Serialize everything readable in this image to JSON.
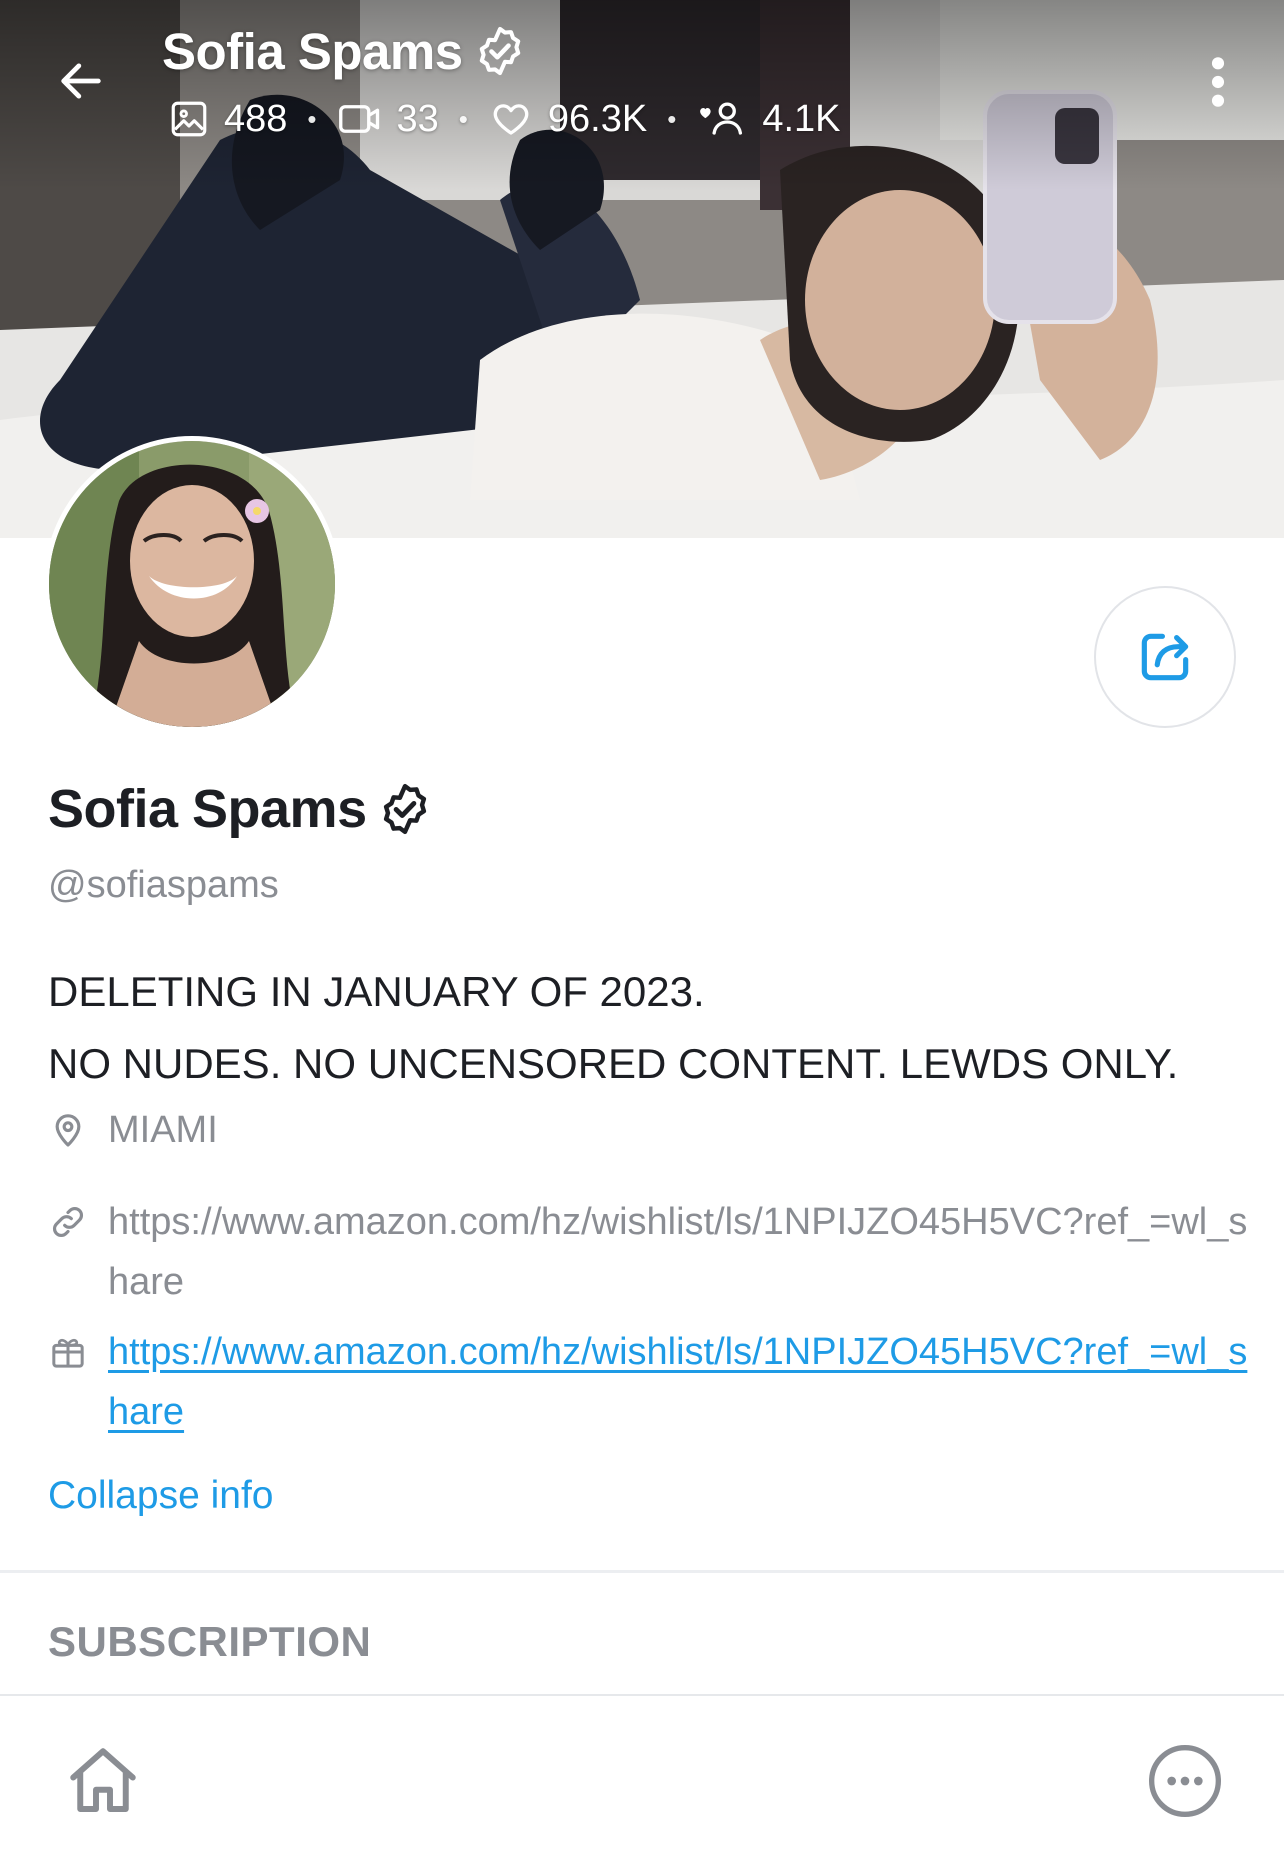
{
  "header": {
    "title": "Sofia Spams",
    "stats": {
      "photos": "488",
      "videos": "33",
      "likes": "96.3K",
      "fans": "4.1K"
    },
    "separator": "•"
  },
  "profile": {
    "name": "Sofia Spams",
    "handle": "@sofiaspams",
    "bio_lines": [
      "DELETING IN JANUARY OF 2023.",
      "NO NUDES. NO UNCENSORED CONTENT. LEWDS ONLY."
    ],
    "location": "MIAMI",
    "website": "https://www.amazon.com/hz/wishlist/ls/1NPIJZO45H5VC?ref_=wl_share",
    "wishlist": "https://www.amazon.com/hz/wishlist/ls/1NPIJZO45H5VC?ref_=wl_share",
    "collapse_label": "Collapse info"
  },
  "sections": {
    "subscription": "SUBSCRIPTION"
  },
  "icons": {
    "back": "arrow-left-icon",
    "verified": "verified-badge-icon",
    "photos": "image-icon",
    "videos": "video-icon",
    "likes": "heart-icon",
    "fans": "fans-icon",
    "more": "vertical-dots-icon",
    "share": "share-icon",
    "location": "location-pin-icon",
    "website": "link-icon",
    "wishlist": "gift-icon",
    "home": "home-icon",
    "menu": "more-circle-icon"
  },
  "colors": {
    "accent": "#1e9be6",
    "muted": "#8a8d93",
    "text": "#1d1f24"
  }
}
